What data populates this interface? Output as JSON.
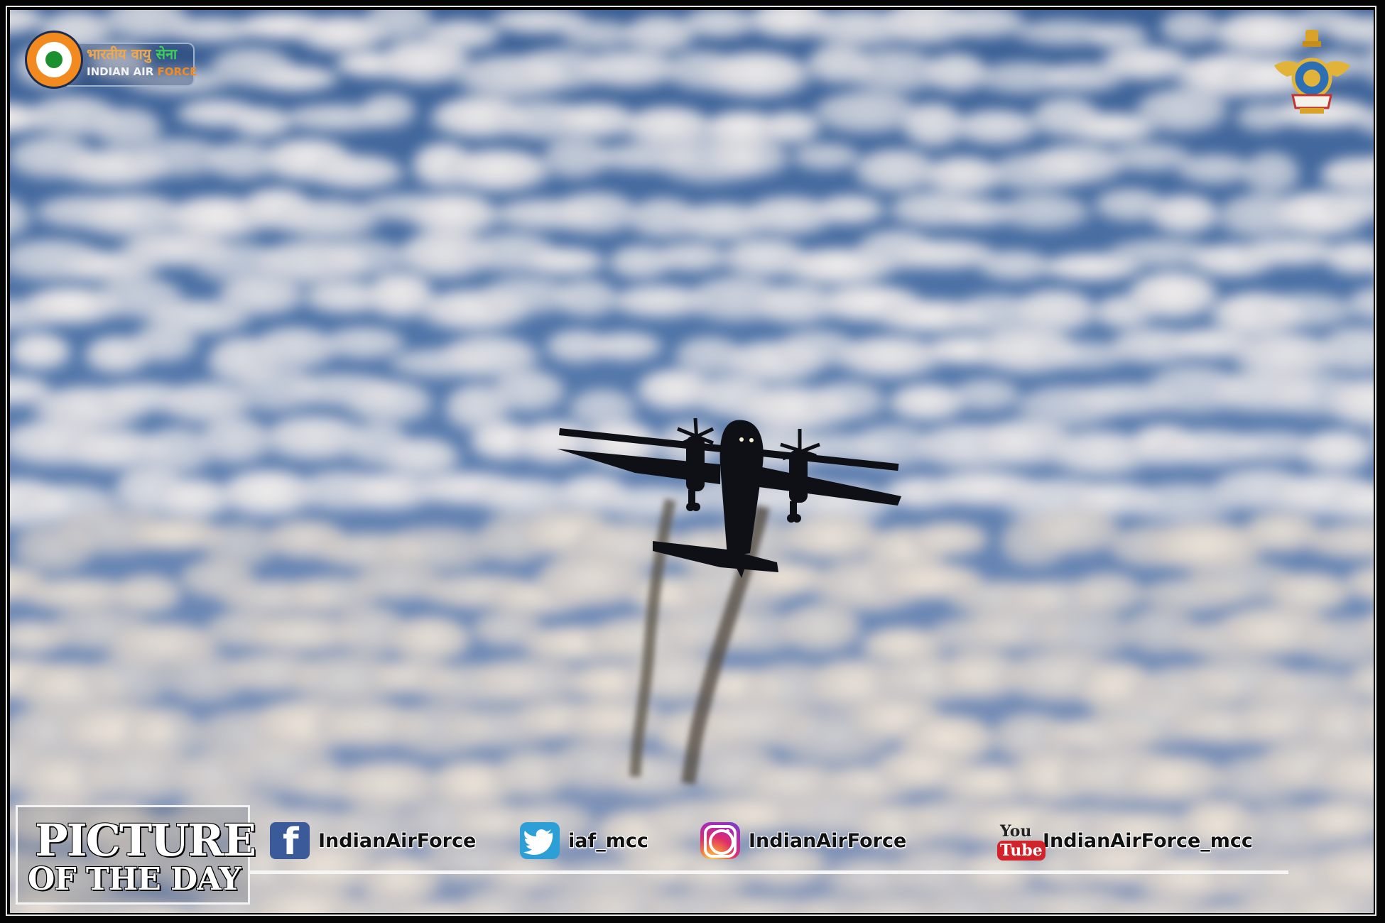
{
  "logo": {
    "hindi_part1": "भारतीय वायु",
    "hindi_part2": "सेना",
    "english_part1": "INDIAN AIR",
    "english_part2": "FORCE",
    "colors": {
      "saffron": "#f28a1f",
      "white": "#ffffff",
      "green": "#1c8f2f"
    }
  },
  "crest": {
    "icon": "iaf-crest-icon"
  },
  "banner": {
    "line1": "PICTURE",
    "line2": "OF THE DAY"
  },
  "social": [
    {
      "icon": "facebook-icon",
      "handle": "IndianAirForce"
    },
    {
      "icon": "twitter-icon",
      "handle": "iaf_mcc"
    },
    {
      "icon": "instagram-icon",
      "handle": "IndianAirForce"
    },
    {
      "icon": "youtube-icon",
      "handle": "IndianAirForce_mcc",
      "badge_you": "You",
      "badge_tube": "Tube"
    }
  ]
}
